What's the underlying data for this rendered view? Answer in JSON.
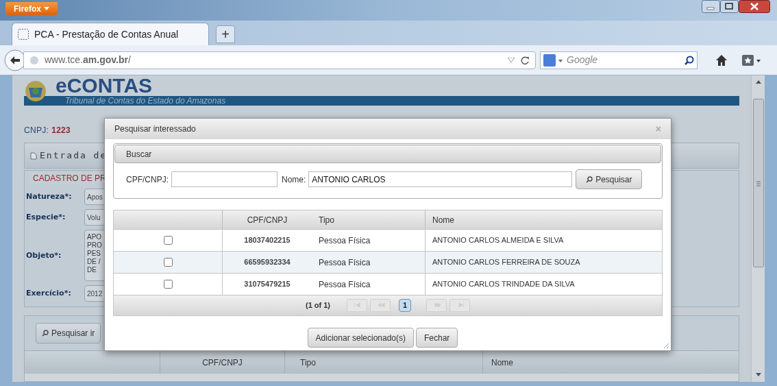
{
  "browser": {
    "menu_button": "Firefox",
    "tab": {
      "title": "PCA - Prestação de Contas Anual",
      "selected": true
    },
    "new_tab": "+",
    "url": "www.tce.**am.gov.br**/",
    "search_placeholder": "Google"
  },
  "page": {
    "logo": "eCONTAS",
    "subtitle": "Tribunal de Contas do Estado do Amazonas",
    "cnpj_label": "CNPJ:",
    "cnpj_value": "1223",
    "panel_title": "Entrada de",
    "legend": "CADASTRO DE PR",
    "fields": [
      {
        "label": "Natureza*:",
        "value": "Apos",
        "kind": "select"
      },
      {
        "label": "Especie*:",
        "value": "Volu",
        "kind": "select"
      },
      {
        "label": "Objeto*:",
        "lines": [
          "APO",
          "PRO",
          "PES",
          "DE /",
          "DE "
        ],
        "kind": "textarea"
      },
      {
        "label": "Exercício*:",
        "value": "2012",
        "kind": "select"
      }
    ],
    "search_button": "Pesquisar ir",
    "table_columns": [
      "CPF/CNPJ",
      "Tipo",
      "Nome"
    ]
  },
  "dialog": {
    "title": "Pesquisar interessado",
    "close": "×",
    "section_title": "Buscar",
    "cpf_label": "CPF/CNPJ:",
    "name_label": "Nome:",
    "name_value": "ANTONIO CARLOS",
    "search_button": "Pesquisar",
    "columns": [
      "CPF/CNPJ",
      "Tipo",
      "Nome"
    ],
    "rows": [
      {
        "checked": false,
        "cpf": "18037402215",
        "tipo": "Pessoa Física",
        "nome": "ANTONIO CARLOS ALMEIDA E SILVA"
      },
      {
        "checked": false,
        "cpf": "66595932334",
        "tipo": "Pessoa Física",
        "nome": "ANTONIO CARLOS FERREIRA DE SOUZA"
      },
      {
        "checked": false,
        "cpf": "31075479215",
        "tipo": "Pessoa Física",
        "nome": "ANTONIO CARLOS TRINDADE DA SILVA"
      }
    ],
    "pager": {
      "summary": "(1 of 1)",
      "controls": [
        {
          "kind": "first",
          "disabled": true
        },
        {
          "kind": "prev",
          "disabled": true
        },
        {
          "kind": "page",
          "label": "1",
          "selected": true
        },
        {
          "kind": "next",
          "disabled": true
        },
        {
          "kind": "last",
          "disabled": true
        }
      ]
    },
    "buttons": [
      "Adicionar selecionado(s)",
      "Fechar"
    ]
  }
}
